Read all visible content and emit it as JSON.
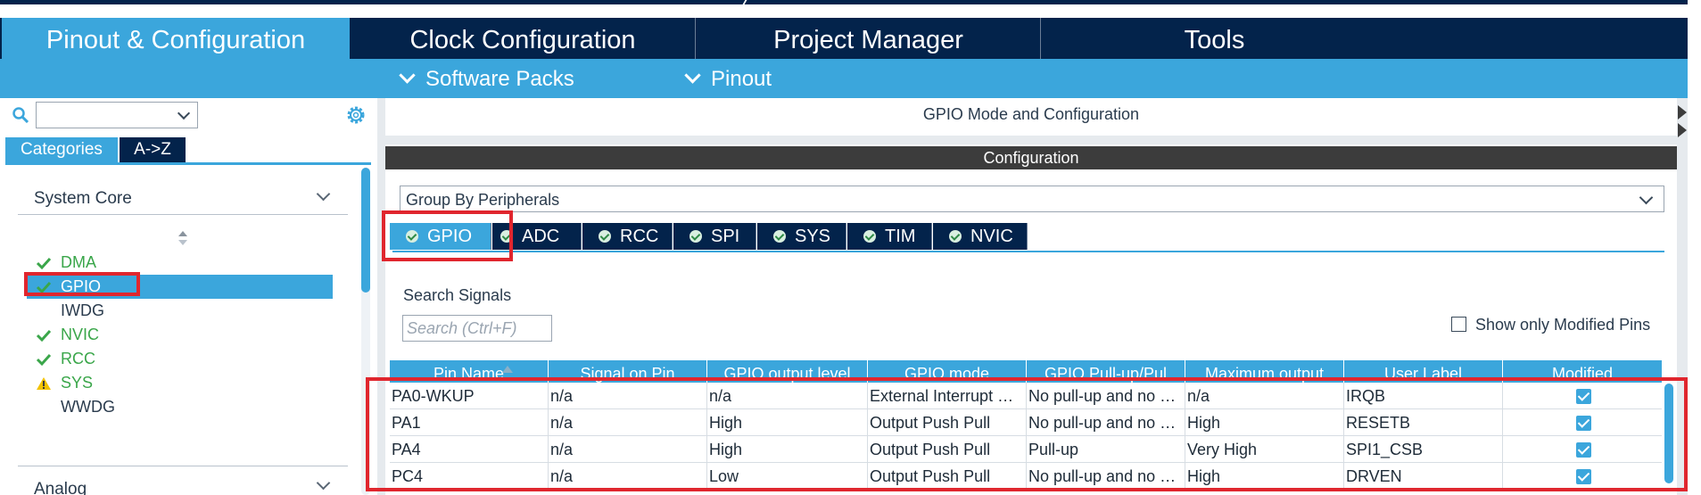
{
  "main_tabs": [
    {
      "label": "Pinout & Configuration",
      "active": true
    },
    {
      "label": "Clock Configuration",
      "active": false
    },
    {
      "label": "Project Manager",
      "active": false
    },
    {
      "label": "Tools",
      "active": false
    }
  ],
  "sub_menu": {
    "software_packs": "Software Packs",
    "pinout": "Pinout"
  },
  "left": {
    "search_value": "",
    "tabs": {
      "categories": "Categories",
      "az": "A->Z"
    },
    "category": "System Core",
    "next_category": "Analog",
    "peripherals": [
      {
        "label": "DMA",
        "status": "ok"
      },
      {
        "label": "GPIO",
        "status": "ok-selected"
      },
      {
        "label": "IWDG",
        "status": "none"
      },
      {
        "label": "NVIC",
        "status": "ok"
      },
      {
        "label": "RCC",
        "status": "ok"
      },
      {
        "label": "SYS",
        "status": "warning"
      },
      {
        "label": "WWDG",
        "status": "none"
      }
    ]
  },
  "right": {
    "title": "GPIO Mode and Configuration",
    "config_label": "Configuration",
    "group_by": "Group By Peripherals",
    "tabs": [
      "GPIO",
      "ADC",
      "RCC",
      "SPI",
      "SYS",
      "TIM",
      "NVIC"
    ],
    "active_tab": "GPIO",
    "search_label": "Search Signals",
    "search_placeholder": "Search (Ctrl+F)",
    "show_modified": "Show only Modified Pins",
    "table": {
      "columns": [
        "Pin Name",
        "Signal on Pin",
        "GPIO output level",
        "GPIO mode",
        "GPIO Pull-up/Pul",
        "Maximum output",
        "User Label",
        "Modified"
      ],
      "rows": [
        [
          "PA0-WKUP",
          "n/a",
          "n/a",
          "External Interrupt Mode with Rising edge",
          "No pull-up and no pull-down",
          "n/a",
          "IRQB",
          true
        ],
        [
          "PA1",
          "n/a",
          "High",
          "Output Push Pull",
          "No pull-up and no pull-down",
          "High",
          "RESETB",
          true
        ],
        [
          "PA4",
          "n/a",
          "High",
          "Output Push Pull",
          "Pull-up",
          "Very High",
          "SPI1_CSB",
          true
        ],
        [
          "PC4",
          "n/a",
          "Low",
          "Output Push Pull",
          "No pull-up and no pull-down",
          "High",
          "DRVEN",
          true
        ]
      ]
    }
  },
  "colors": {
    "navy": "#03234b",
    "accent": "#3ba6dc",
    "ok": "#3aa64a",
    "warning": "#f2c200",
    "highlight": "#e0262e"
  }
}
